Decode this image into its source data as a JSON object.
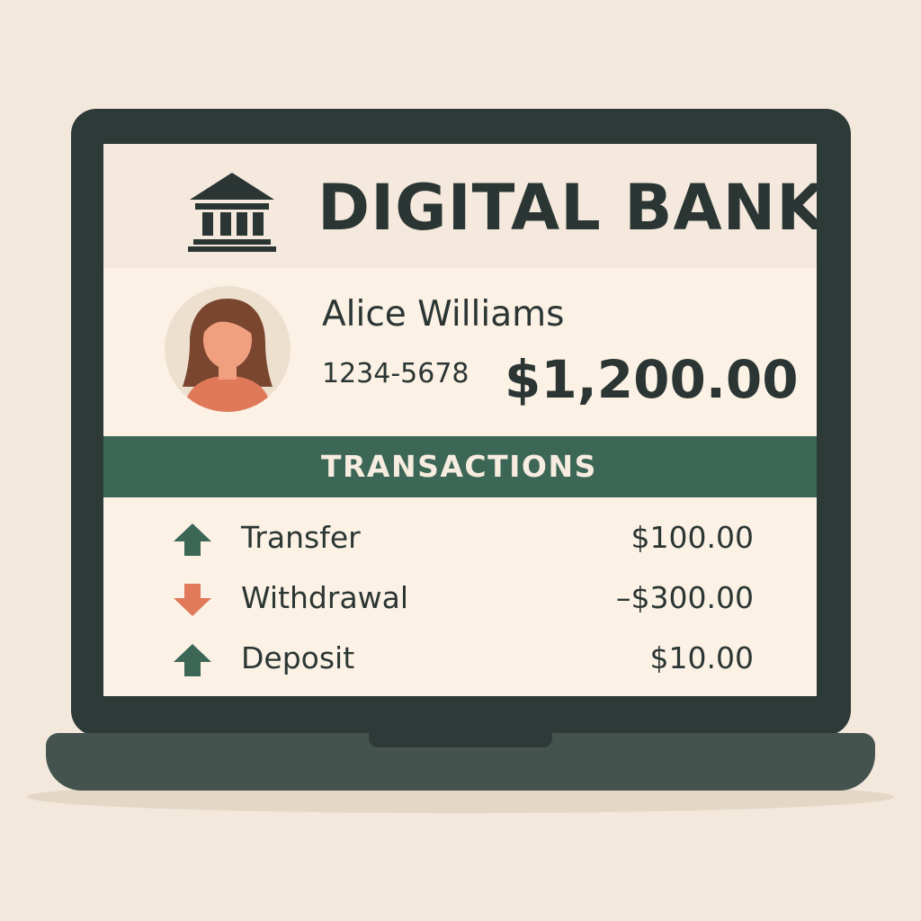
{
  "app": {
    "title": "DIGITAL BANK",
    "logo_icon": "bank-icon"
  },
  "account": {
    "holder_name": "Alice Williams",
    "account_number": "1234-5678",
    "balance": "$1,200.00",
    "avatar_icon": "user-avatar"
  },
  "transactions": {
    "heading": "TRANSACTIONS",
    "items": [
      {
        "label": "Transfer",
        "amount": "$100.00",
        "direction": "up",
        "icon": "arrow-up-icon"
      },
      {
        "label": "Withdrawal",
        "amount": "–$300.00",
        "direction": "down",
        "icon": "arrow-down-icon"
      },
      {
        "label": "Deposit",
        "amount": "$10.00",
        "direction": "up",
        "icon": "arrow-up-icon"
      }
    ]
  },
  "colors": {
    "background": "#f3e8dc",
    "laptop": "#2d3a38",
    "screen": "#fbf1e4",
    "accent_green": "#3c6656",
    "arrow_up": "#3c6656",
    "arrow_down": "#e07a5a",
    "text": "#2b3634"
  }
}
